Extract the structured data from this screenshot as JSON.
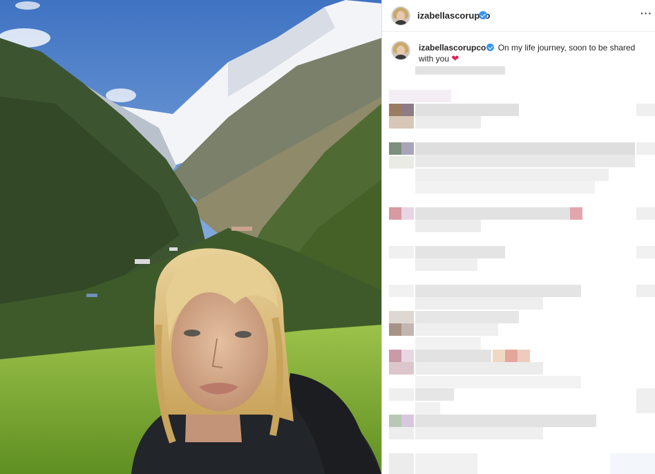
{
  "post": {
    "username": "izabellascorupco",
    "caption_text": "On my life journey, soon to be shared with you",
    "caption_emoji": "❤",
    "more_options": "···"
  },
  "icons": {
    "verified": "verified-badge-icon",
    "heart": "red-heart-emoji",
    "more": "more-options-icon"
  },
  "colors": {
    "verified": "#3897f0",
    "heart": "#e0245e",
    "divider": "#dbdbdb"
  }
}
